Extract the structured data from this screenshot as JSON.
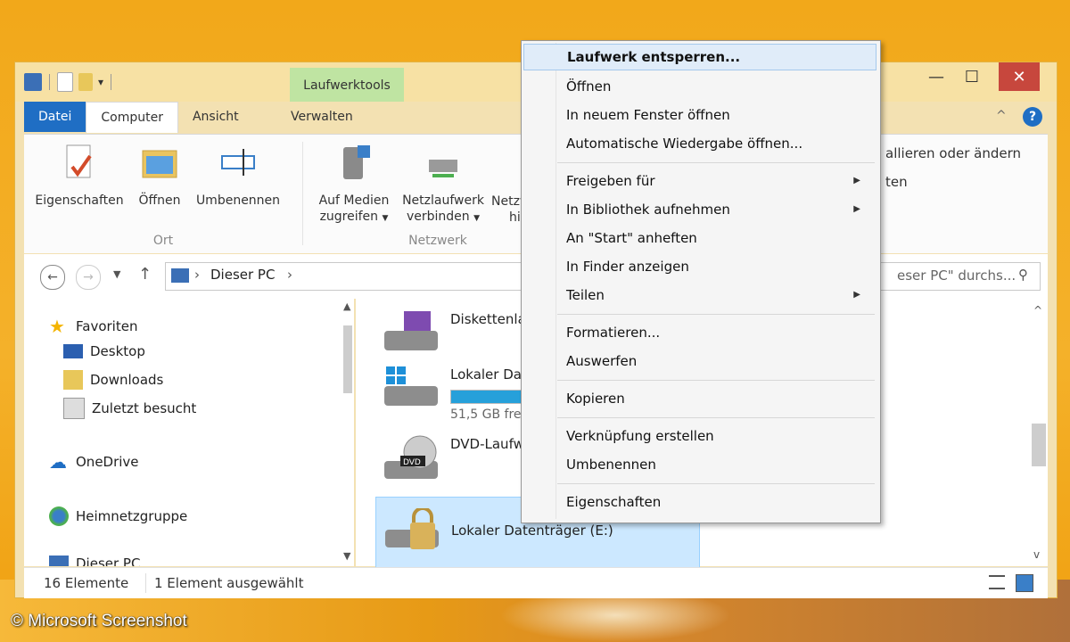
{
  "window": {
    "contextual_tab_group": "Laufwerktools",
    "tabs": {
      "file": "Datei",
      "computer": "Computer",
      "view": "Ansicht",
      "manage": "Verwalten"
    },
    "controls": {
      "minimize": "—",
      "maximize": "☐",
      "close": "✕"
    },
    "help": "?"
  },
  "ribbon": {
    "ort": {
      "label": "Ort",
      "properties": "Eigenschaften",
      "open": "Öffnen",
      "rename": "Umbenennen"
    },
    "netzwerk": {
      "label": "Netzwerk",
      "access_media_1": "Auf Medien",
      "access_media_2": "zugreifen",
      "map_drive_1": "Netzlaufwerk",
      "map_drive_2": "verbinden",
      "net_loc_1": "Netzw",
      "net_loc_2": "hin"
    },
    "right_text_1": "allieren oder ändern",
    "right_text_2": "ten"
  },
  "address": {
    "path_root": "Dieser PC",
    "search_placeholder": "eser PC\" durchs...",
    "chevron": "›"
  },
  "sidebar": {
    "favorites": "Favoriten",
    "desktop": "Desktop",
    "downloads": "Downloads",
    "recent": "Zuletzt besucht",
    "onedrive": "OneDrive",
    "homegroup": "Heimnetzgruppe",
    "thispc_partial": "Dieser PC"
  },
  "drives": [
    {
      "name": "Diskettenla",
      "sub": ""
    },
    {
      "name": "Lokaler Da",
      "sub": "51,5 GB fre",
      "fill_percent": 0.5
    },
    {
      "name": "DVD-Laufw",
      "sub": ""
    },
    {
      "name": "Lokaler Datenträger (E:)",
      "sub": ""
    }
  ],
  "status": {
    "count": "16 Elemente",
    "selected": "1 Element ausgewählt"
  },
  "context_menu": {
    "items": [
      "Laufwerk entsperren...",
      "Öffnen",
      "In neuem Fenster öffnen",
      "Automatische Wiedergabe öffnen...",
      "Freigeben für",
      "In Bibliothek aufnehmen",
      "An \"Start\" anheften",
      "In Finder anzeigen",
      "Teilen",
      "Formatieren...",
      "Auswerfen",
      "Kopieren",
      "Verknüpfung erstellen",
      "Umbenennen",
      "Eigenschaften"
    ],
    "submenu_arrow": "▶"
  },
  "credit": "© Microsoft Screenshot",
  "colors": {
    "file_tab": "#1f6ec4",
    "context_tab": "#bfe4a2",
    "selection": "#cce8ff",
    "close": "#c7473d",
    "accent": "#26a0da"
  }
}
